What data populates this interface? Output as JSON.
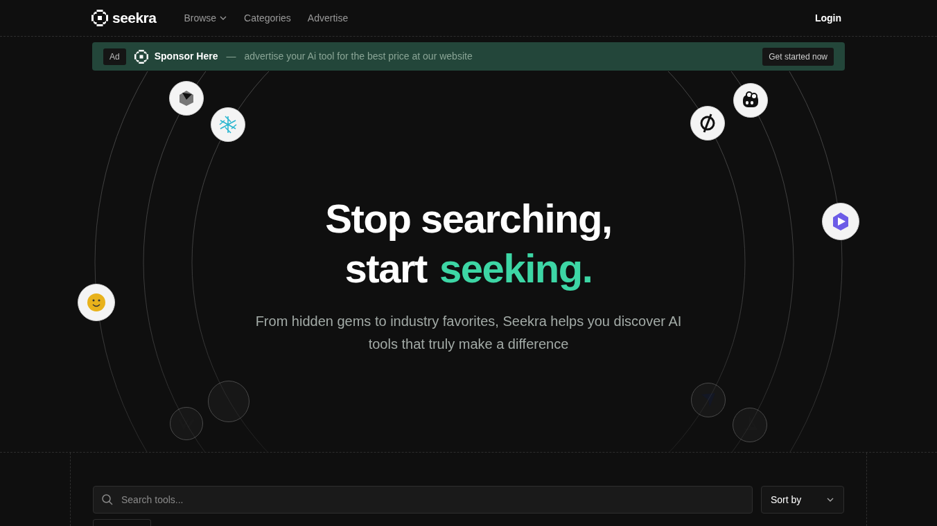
{
  "nav": {
    "brand": "seekra",
    "links": [
      {
        "label": "Browse",
        "dropdown": true
      },
      {
        "label": "Categories",
        "dropdown": false
      },
      {
        "label": "Advertise",
        "dropdown": false
      }
    ],
    "login": "Login"
  },
  "ad": {
    "tag": "Ad",
    "sponsor": "Sponsor Here",
    "dash": "—",
    "text": "advertise your Ai tool for the best price at our website",
    "cta": "Get started now"
  },
  "hero": {
    "line1": "Stop searching,",
    "line2": "start",
    "highlight": "seeking.",
    "subtitle": "From hidden gems to industry favorites, Seekra helps you discover AI tools that truly make a difference"
  },
  "search": {
    "placeholder": "Search tools...",
    "sort": "Sort by"
  }
}
